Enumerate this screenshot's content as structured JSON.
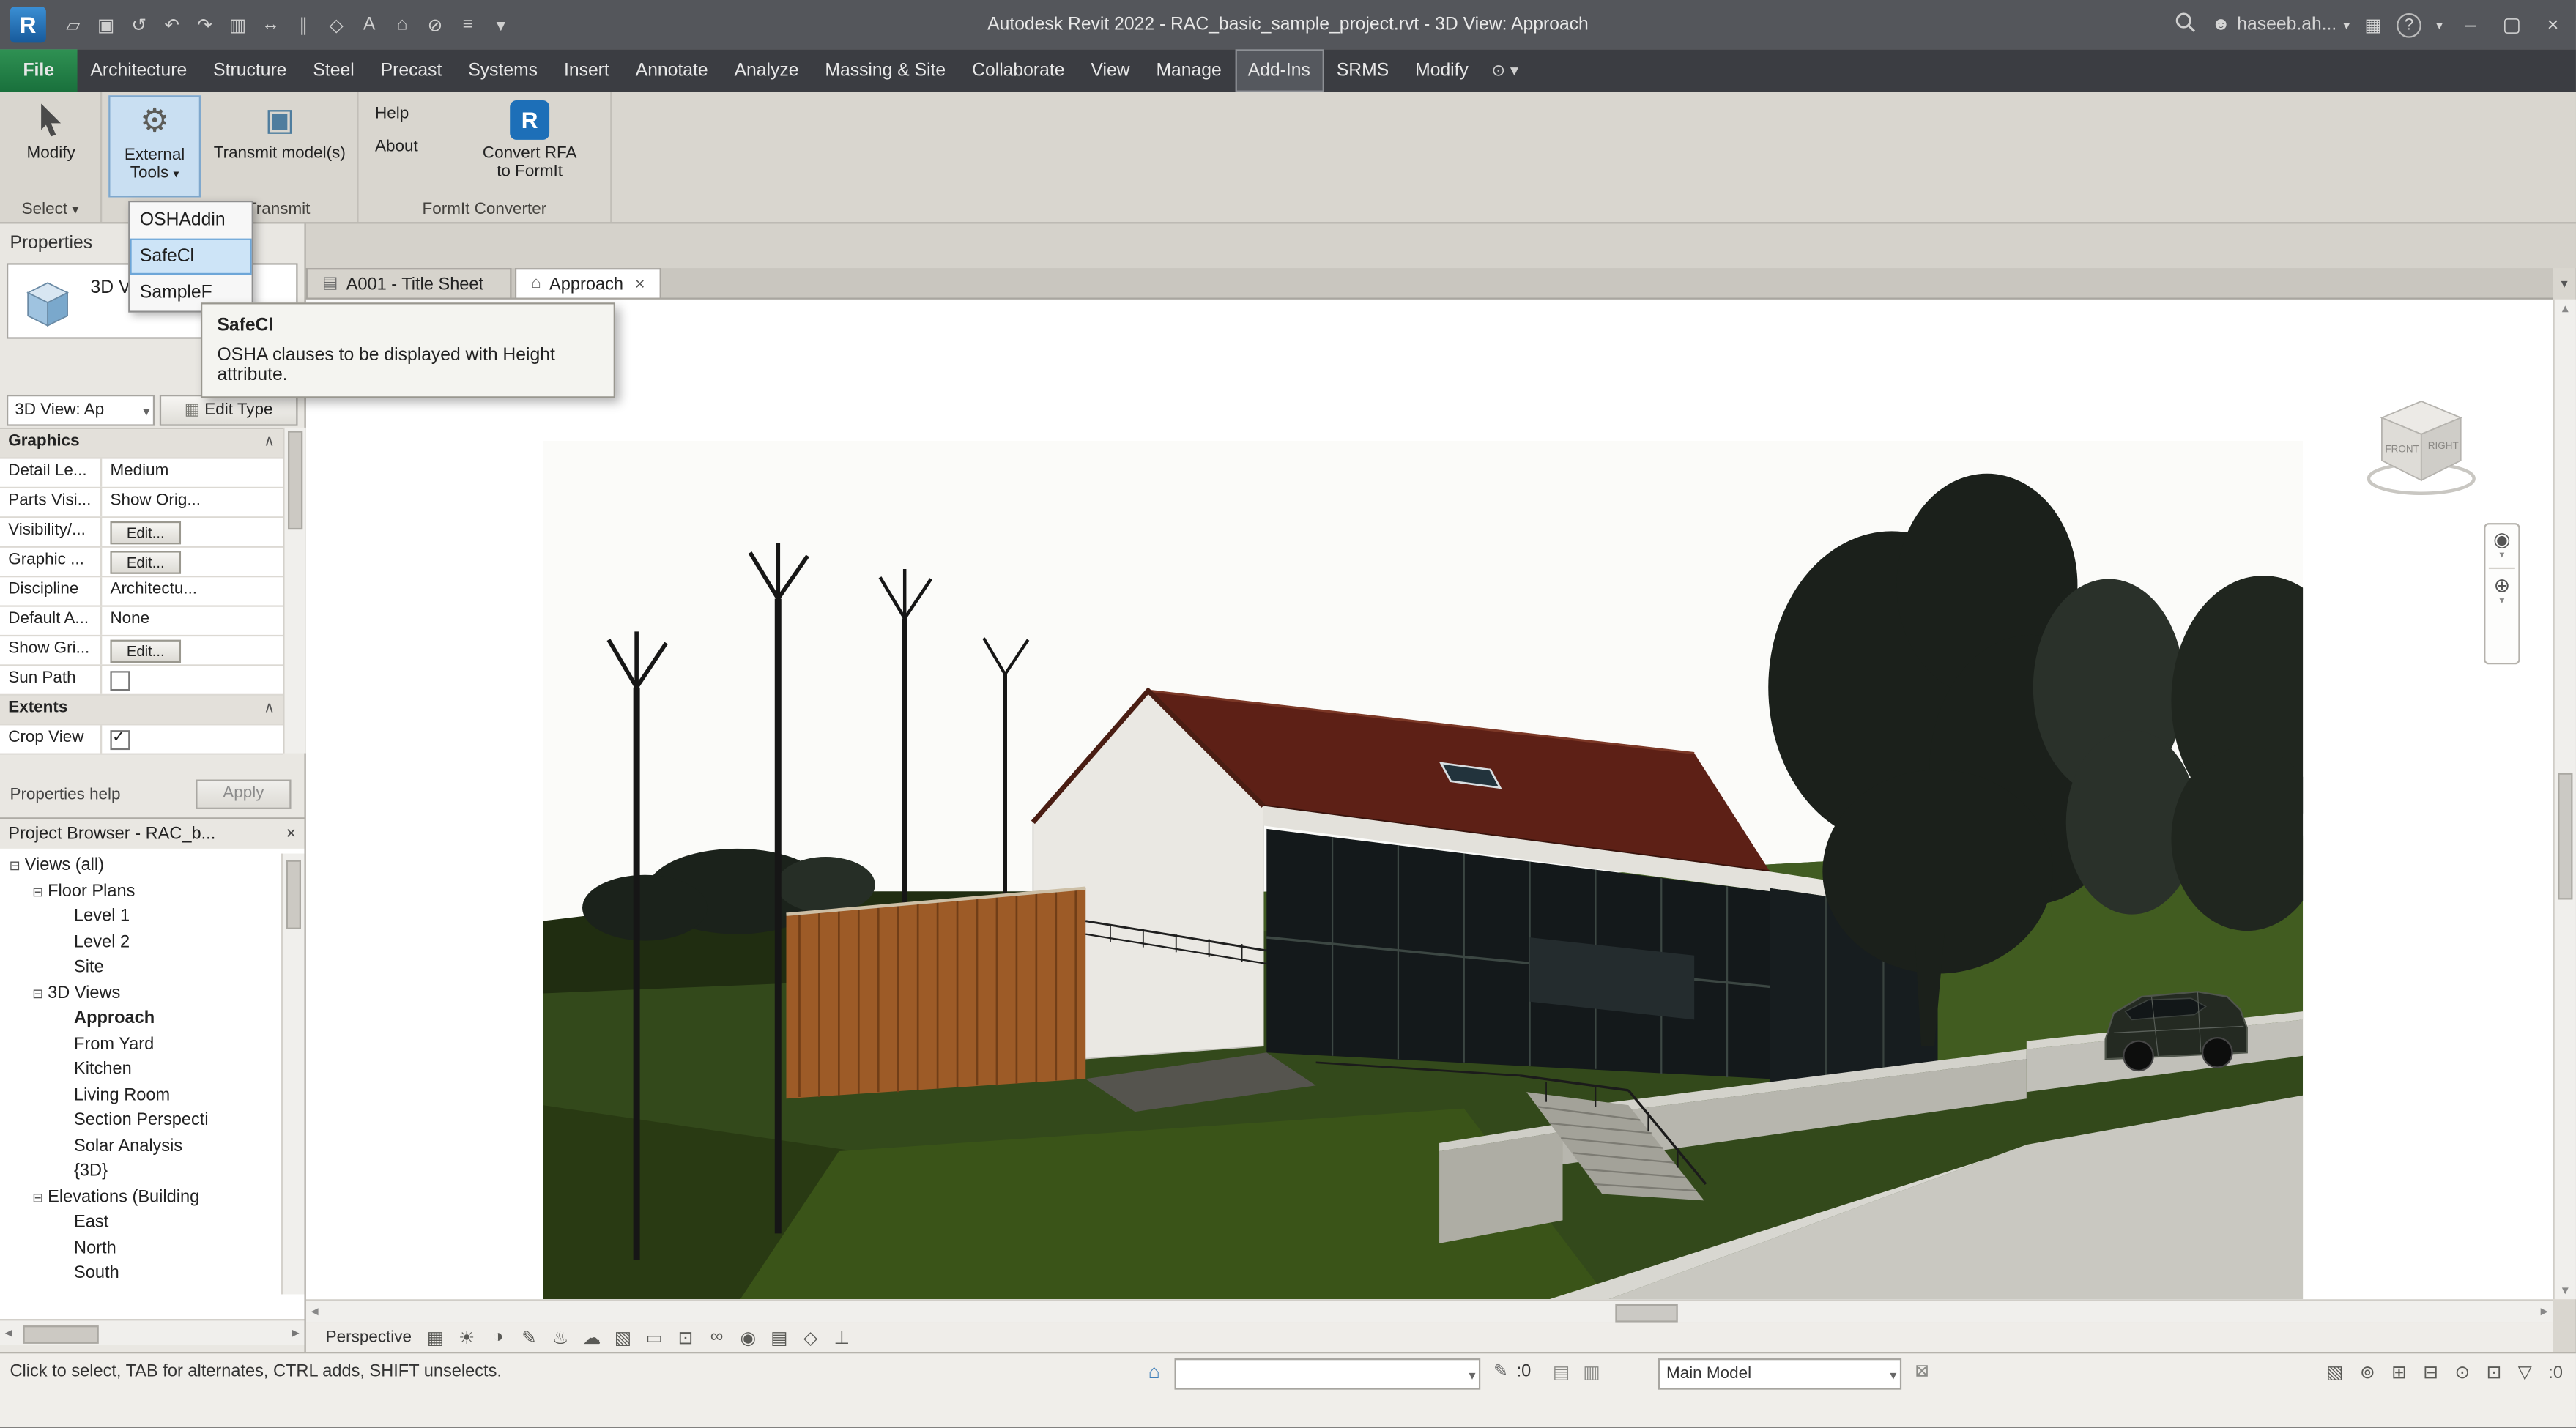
{
  "titlebar": {
    "logo_letter": "R",
    "title": "Autodesk Revit 2022 - RAC_basic_sample_project.rvt - 3D View: Approach",
    "qat": [
      {
        "name": "open-icon",
        "glyph": "▱"
      },
      {
        "name": "save-icon",
        "glyph": "▣"
      },
      {
        "name": "sync-with-central-icon",
        "glyph": "↺"
      },
      {
        "name": "undo-icon",
        "glyph": "↶"
      },
      {
        "name": "redo-icon",
        "glyph": "↷"
      },
      {
        "name": "print-icon",
        "glyph": "▥"
      },
      {
        "name": "measure-icon",
        "glyph": "↔"
      },
      {
        "name": "aligned-dimension-icon",
        "glyph": "∥"
      },
      {
        "name": "tag-icon",
        "glyph": "◇"
      },
      {
        "name": "text-icon",
        "glyph": "A"
      },
      {
        "name": "default-3d-view-icon",
        "glyph": "⌂"
      },
      {
        "name": "section-icon",
        "glyph": "⊘"
      },
      {
        "name": "thin-lines-icon",
        "glyph": "≡"
      },
      {
        "name": "qat-customize-caret",
        "glyph": "▾"
      }
    ],
    "account": {
      "icon_glyph": "☻",
      "user_name": "haseeb.ah...",
      "caret": "▾"
    },
    "store_glyph": "▦",
    "help_glyph": "?",
    "help_caret": "▾",
    "window_min": "–",
    "window_max": "▢",
    "window_close": "×"
  },
  "glyphs": {
    "caret_down": "▾",
    "caret_up": "▴",
    "arrow_left": "◂",
    "arrow_right": "▸",
    "combo_caret": "▾"
  },
  "ribbon": {
    "file_tab": "File",
    "tabs": [
      {
        "label": "Architecture"
      },
      {
        "label": "Structure"
      },
      {
        "label": "Steel"
      },
      {
        "label": "Precast"
      },
      {
        "label": "Systems"
      },
      {
        "label": "Insert"
      },
      {
        "label": "Annotate"
      },
      {
        "label": "Analyze"
      },
      {
        "label": "Massing & Site"
      },
      {
        "label": "Collaborate"
      },
      {
        "label": "View"
      },
      {
        "label": "Manage"
      },
      {
        "label": "Add-Ins",
        "active": true
      },
      {
        "label": "SRMS"
      },
      {
        "label": "Modify"
      }
    ],
    "modify_circle": "⊙",
    "panels": {
      "select": {
        "button": "Modify",
        "label": "Select"
      },
      "transmit": {
        "external_tools_line1": "External",
        "external_tools_line2": "Tools",
        "transmit_models": "Transmit model(s)",
        "label": "Transmit",
        "external_icon": "⚙",
        "transmit_icon": "▣"
      },
      "formit": {
        "help": "Help",
        "about": "About",
        "convert_icon_letter": "R",
        "convert_line1": "Convert RFA",
        "convert_line2": "to FormIt",
        "label": "FormIt Converter"
      }
    }
  },
  "external_tools_menu": {
    "items": [
      {
        "label": "OSHAddin"
      },
      {
        "label": "SafeCl",
        "highlighted": true
      },
      {
        "label": "SampleF"
      }
    ]
  },
  "tooltip": {
    "title": "SafeCl",
    "body": "OSHA clauses to be displayed with Height attribute."
  },
  "view_tabs": {
    "tabs": [
      {
        "label": "A001 - Title Sheet",
        "icon": "▤"
      },
      {
        "label": "Approach",
        "icon": "⌂",
        "close": "×",
        "active": true
      }
    ],
    "list_caret": "▾"
  },
  "properties": {
    "header": "Properties",
    "type_selector": {
      "name": "3D View"
    },
    "view_selector": {
      "value": "3D View: Ap"
    },
    "edit_type": {
      "icon": "▦",
      "label": "Edit Type"
    },
    "sections": {
      "graphics": "Graphics",
      "extents": "Extents"
    },
    "section_caret": "∧",
    "rows": [
      {
        "label": "Detail Le...",
        "value": "Medium",
        "kind": "text"
      },
      {
        "label": "Parts Visi...",
        "value": "Show Orig...",
        "kind": "text"
      },
      {
        "label": "Visibility/...",
        "value": "Edit...",
        "kind": "button"
      },
      {
        "label": "Graphic ...",
        "value": "Edit...",
        "kind": "button"
      },
      {
        "label": "Discipline",
        "value": "Architectu...",
        "kind": "text"
      },
      {
        "label": "Default A...",
        "value": "None",
        "kind": "text"
      },
      {
        "label": "Show Gri...",
        "value": "Edit...",
        "kind": "button"
      },
      {
        "label": "Sun Path",
        "value": "",
        "kind": "checkbox",
        "checked": false
      },
      {
        "label": "Crop View",
        "value": "",
        "kind": "checkbox",
        "checked": true
      }
    ],
    "help_link": "Properties help",
    "apply_label": "Apply"
  },
  "project_browser": {
    "title": "Project Browser - RAC_b...",
    "close": "×",
    "tree": [
      {
        "label": "Views (all)",
        "level": 0,
        "expander": "⊟"
      },
      {
        "label": "Floor Plans",
        "level": 1,
        "expander": "⊟"
      },
      {
        "label": "Level 1",
        "level": 2,
        "expander": ""
      },
      {
        "label": "Level 2",
        "level": 2,
        "expander": ""
      },
      {
        "label": "Site",
        "level": 2,
        "expander": ""
      },
      {
        "label": "3D Views",
        "level": 1,
        "expander": "⊟"
      },
      {
        "label": "Approach",
        "level": 2,
        "expander": "",
        "selected": true
      },
      {
        "label": "From Yard",
        "level": 2,
        "expander": ""
      },
      {
        "label": "Kitchen",
        "level": 2,
        "expander": ""
      },
      {
        "label": "Living Room",
        "level": 2,
        "expander": ""
      },
      {
        "label": "Section Perspecti",
        "level": 2,
        "expander": ""
      },
      {
        "label": "Solar Analysis",
        "level": 2,
        "expander": ""
      },
      {
        "label": "{3D}",
        "level": 2,
        "expander": ""
      },
      {
        "label": "Elevations (Building",
        "level": 1,
        "expander": "⊟"
      },
      {
        "label": "East",
        "level": 2,
        "expander": ""
      },
      {
        "label": "North",
        "level": 2,
        "expander": ""
      },
      {
        "label": "South",
        "level": 2,
        "expander": ""
      }
    ]
  },
  "viewcube": {
    "front": "FRONT",
    "right": "RIGHT"
  },
  "navbar": {
    "wheel": "◉",
    "zoom": "⊕",
    "caret": "▾"
  },
  "view_control_bar": {
    "view_type": "Perspective",
    "icons": [
      {
        "name": "visual-style-icon",
        "glyph": "▦"
      },
      {
        "name": "sun-path-icon",
        "glyph": "☀"
      },
      {
        "name": "shadows-icon",
        "glyph": "◑"
      },
      {
        "name": "sketchy-lines-icon",
        "glyph": "✎"
      },
      {
        "name": "render-icon",
        "glyph": "♨"
      },
      {
        "name": "render-in-cloud-icon",
        "glyph": "☁"
      },
      {
        "name": "render-gallery-icon",
        "glyph": "▧"
      },
      {
        "name": "crop-view-icon",
        "glyph": "▭"
      },
      {
        "name": "show-crop-region-icon",
        "glyph": "⊡"
      },
      {
        "name": "temporary-hide-isolate-icon",
        "glyph": "∞"
      },
      {
        "name": "reveal-hidden-elements-icon",
        "glyph": "◉"
      },
      {
        "name": "temporary-view-properties-icon",
        "glyph": "▤"
      },
      {
        "name": "show-displacement-sets-icon",
        "glyph": "◇"
      },
      {
        "name": "reveal-constraints-icon",
        "glyph": "⊥"
      }
    ]
  },
  "statusbar": {
    "hint": "Click to select, TAB for alternates, CTRL adds, SHIFT unselects.",
    "workset_icon": "⌂",
    "workset_value": "",
    "editable_glyph": "✎",
    "editable_count": ":0",
    "workset_icons": [
      {
        "name": "show-worksets-icon",
        "glyph": "▤"
      },
      {
        "name": "gray-inactive-worksets-icon",
        "glyph": "▥"
      }
    ],
    "design_option_value": "Main Model",
    "exclude_options_glyph": "⊠",
    "right_icons": [
      {
        "name": "worksharing-display-icon",
        "glyph": "▧"
      },
      {
        "name": "background-processes-icon",
        "glyph": "⊚"
      },
      {
        "name": "select-links-icon",
        "glyph": "⊞"
      },
      {
        "name": "select-underlay-elements-icon",
        "glyph": "⊟"
      },
      {
        "name": "select-pinned-elements-icon",
        "glyph": "⊙"
      },
      {
        "name": "drag-elements-on-selection-icon",
        "glyph": "⊡"
      }
    ],
    "filter_glyph": "▽",
    "filter_count": ":0"
  },
  "scene_colors": {
    "grass_dark": "#33491b",
    "grass_light": "#415c22",
    "roof": "#5d2016",
    "wall_white": "#eae8e3",
    "glass": "#14191b",
    "wood": "#9d5b27",
    "tree": "#1b201b",
    "concrete": "#b7b6ae",
    "road": "#c9c8c1",
    "sky": "#fbfbf9"
  }
}
